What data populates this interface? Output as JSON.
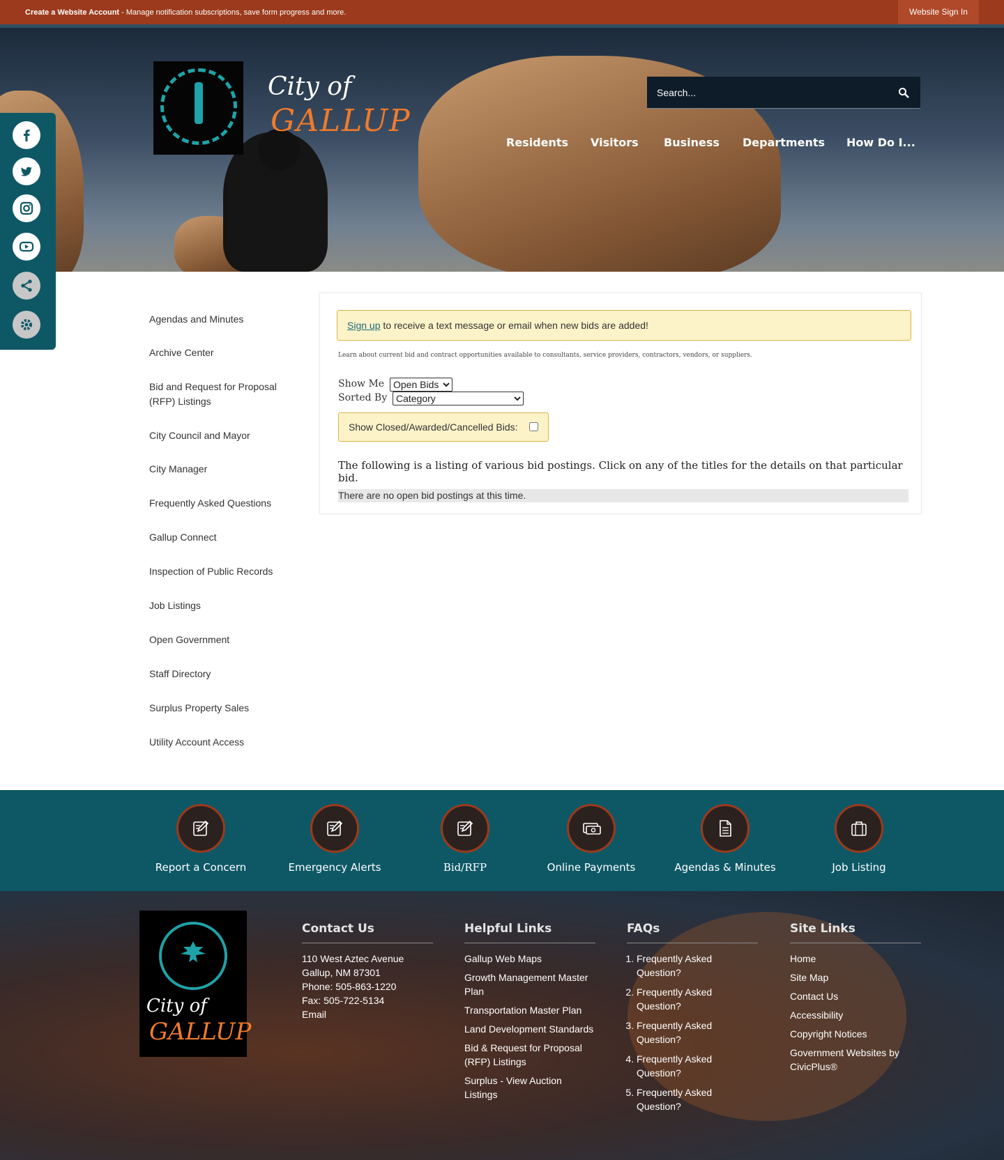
{
  "topbar": {
    "create_account": "Create a Website Account",
    "create_account_rest": " - Manage notification subscriptions, save form progress and more.",
    "sign_in": "Website Sign In"
  },
  "header": {
    "brand_line1": "City of",
    "brand_line2": "GALLUP",
    "search_placeholder": "Search...",
    "nav": [
      "Residents",
      "Visitors",
      "Business",
      "Departments",
      "How Do I..."
    ]
  },
  "social": [
    "facebook-icon",
    "twitter-icon",
    "instagram-icon",
    "youtube-icon",
    "share-icon",
    "gear-icon"
  ],
  "sidebar": {
    "items": [
      "Agendas and Minutes",
      "Archive Center",
      "Bid and Request for Proposal (RFP) Listings",
      "City Council and Mayor",
      "City Manager",
      "Frequently Asked Questions",
      "Gallup Connect",
      "Inspection of Public Records",
      "Job Listings",
      "Open Government",
      "Staff Directory",
      "Surplus Property Sales",
      "Utility Account Access"
    ]
  },
  "content": {
    "signup_link": "Sign up",
    "signup_text": " to receive a text message or email when new bids are added!",
    "intro": "Learn about current bid and contract opportunities available to consultants, service providers, contractors, vendors, or suppliers.",
    "show_me_label": "Show Me",
    "show_me_value": "Open Bids",
    "sorted_by_label": "Sorted By",
    "sorted_by_value": "Category",
    "closed_label": "Show Closed/Awarded/Cancelled Bids:",
    "listing_text": "The following is a listing of various bid postings. Click on any of the titles for the details on that particular bid.",
    "no_bids": "There are no open bid postings at this time."
  },
  "quick_links": [
    {
      "label": "Report a Concern",
      "icon": "edit-icon"
    },
    {
      "label": "Emergency Alerts",
      "icon": "edit-icon"
    },
    {
      "label": "Bid/RFP",
      "icon": "edit-icon"
    },
    {
      "label": "Online Payments",
      "icon": "payment-icon"
    },
    {
      "label": "Agendas & Minutes",
      "icon": "document-icon"
    },
    {
      "label": "Job Listing",
      "icon": "briefcase-icon"
    }
  ],
  "footer": {
    "logo_line1": "City of",
    "logo_line2": "GALLUP",
    "contact": {
      "title": "Contact Us",
      "address1": "110 West Aztec Avenue",
      "address2": "Gallup, NM 87301",
      "phone": "Phone: 505-863-1220",
      "fax": "Fax: 505-722-5134",
      "email": "Email"
    },
    "helpful": {
      "title": "Helpful Links",
      "links": [
        "Gallup Web Maps",
        "Growth Management Master Plan",
        "Transportation Master Plan",
        "Land Development Standards",
        "Bid & Request for Proposal (RFP) Listings",
        "Surplus - View Auction Listings"
      ]
    },
    "faqs": {
      "title": "FAQs",
      "items": [
        "Frequently Asked Question?",
        "Frequently Asked Question?",
        "Frequently Asked Question?",
        "Frequently Asked Question?",
        "Frequently Asked Question?"
      ]
    },
    "site": {
      "title": "Site Links",
      "links": [
        "Home",
        "Site Map",
        "Contact Us",
        "Accessibility",
        "Copyright Notices",
        "Government Websites by CivicPlus®"
      ]
    }
  },
  "colors": {
    "topbar": "#9b3a1c",
    "teal": "#0e5866",
    "accent_orange": "#f07b2a",
    "alert_bg": "#fdf3c9"
  }
}
